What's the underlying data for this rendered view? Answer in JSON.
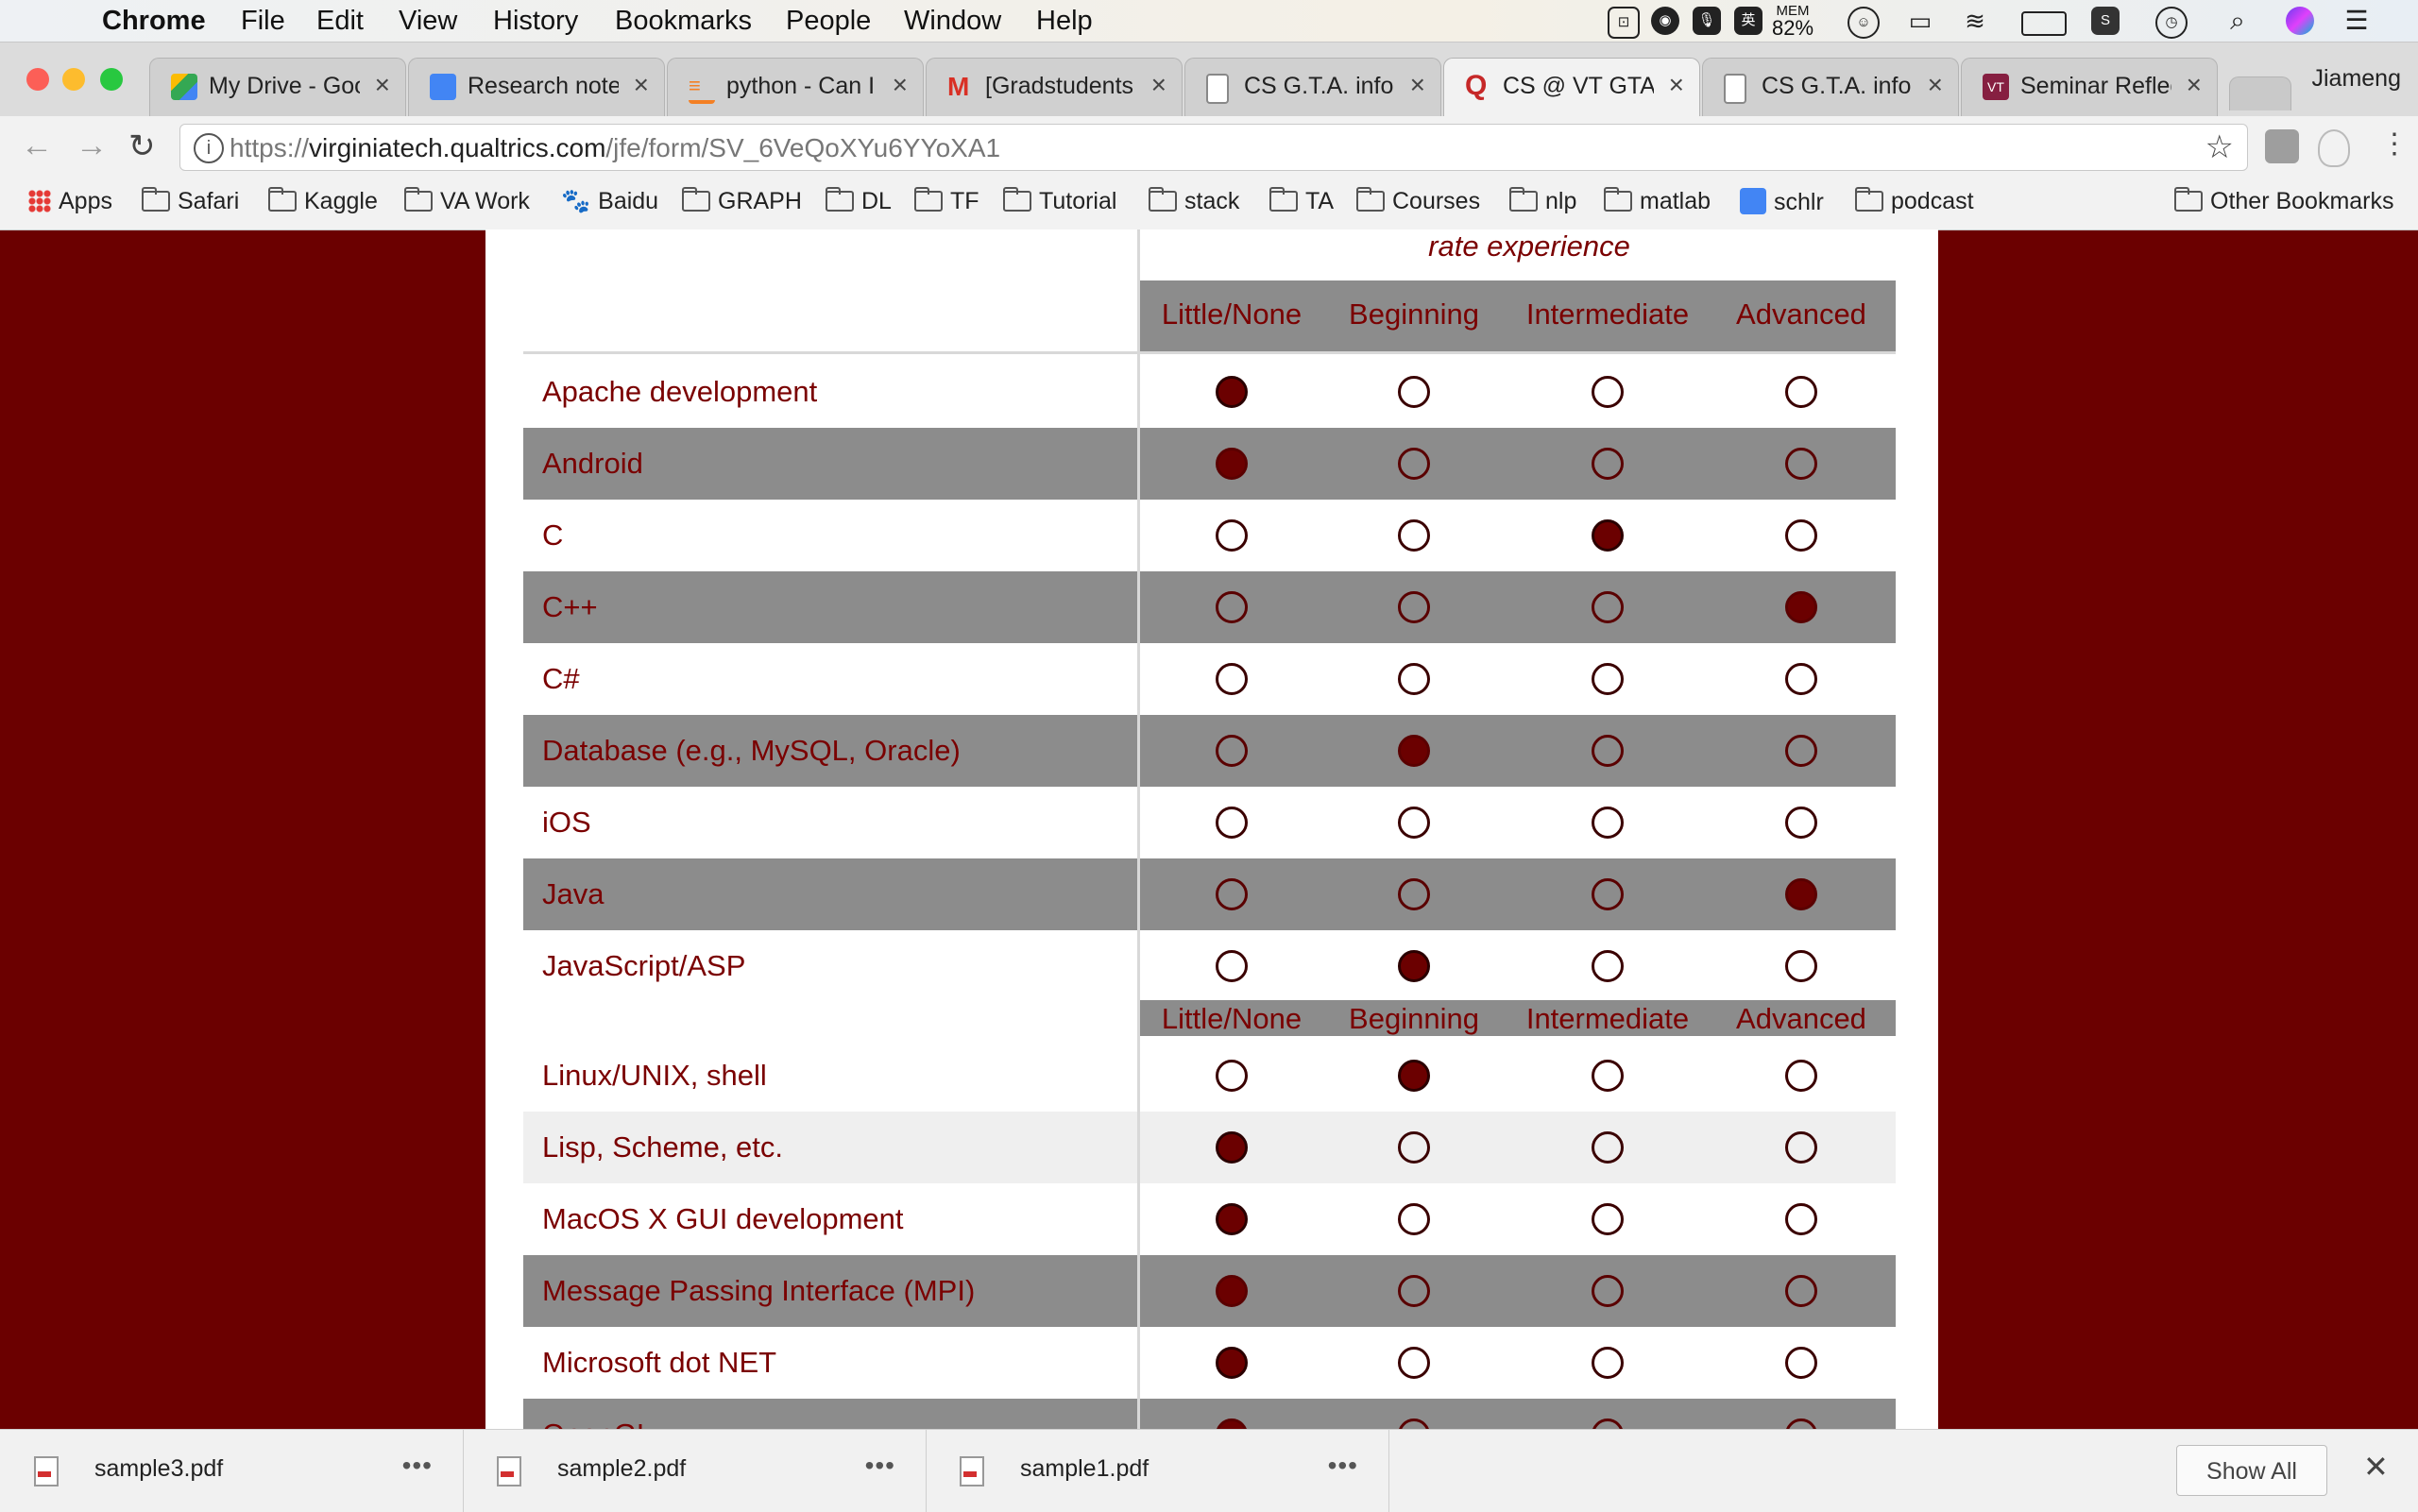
{
  "menubar": {
    "app": "Chrome",
    "items": [
      "File",
      "Edit",
      "View",
      "History",
      "Bookmarks",
      "People",
      "Window",
      "Help"
    ],
    "mem_label": "MEM",
    "mem_value": "82%"
  },
  "tabs": [
    {
      "title": "My Drive - Goo",
      "favicon_color": "#34a853"
    },
    {
      "title": "Research note",
      "favicon_color": "#4285f4"
    },
    {
      "title": "python - Can I",
      "favicon_color": "#f48024"
    },
    {
      "title": "[Gradstudents",
      "favicon_color": "#d93025"
    },
    {
      "title": "CS G.T.A. infor",
      "favicon_color": "#9e9e9e"
    },
    {
      "title": "CS @ VT GTA",
      "favicon_color": "#c62828",
      "active": true
    },
    {
      "title": "CS G.T.A. infor",
      "favicon_color": "#9e9e9e"
    },
    {
      "title": "Seminar Reflec",
      "favicon_color": "#861f41"
    }
  ],
  "profile_name": "Jiameng",
  "address_bar": {
    "scheme": "https://",
    "host": "virginiatech.qualtrics.com",
    "path": "/jfe/form/SV_6VeQoXYu6YYoXA1"
  },
  "bookmarks": {
    "apps": "Apps",
    "items": [
      "Safari",
      "Kaggle",
      "VA Work",
      "Baidu",
      "GRAPH",
      "DL",
      "TF",
      "Tutorial",
      "stack",
      "TA",
      "Courses",
      "nlp",
      "matlab",
      "schlr",
      "podcast"
    ],
    "other": "Other Bookmarks"
  },
  "survey": {
    "column_group_label": "rate experience",
    "columns": [
      "Little/None",
      "Beginning",
      "Intermediate",
      "Advanced"
    ],
    "rows": [
      {
        "label": "Apache development",
        "selected": 0
      },
      {
        "label": "Android",
        "selected": 0
      },
      {
        "label": "C",
        "selected": 2
      },
      {
        "label": "C++",
        "selected": 3
      },
      {
        "label": "C#",
        "selected": null
      },
      {
        "label": "Database (e.g., MySQL, Oracle)",
        "selected": 1
      },
      {
        "label": "iOS",
        "selected": null
      },
      {
        "label": "Java",
        "selected": 3
      },
      {
        "label": "JavaScript/ASP",
        "selected": 1
      },
      {
        "label": "Linux/UNIX, shell",
        "selected": 1
      },
      {
        "label": "Lisp, Scheme, etc.",
        "selected": 0
      },
      {
        "label": "MacOS X GUI development",
        "selected": 0
      },
      {
        "label": "Message Passing Interface (MPI)",
        "selected": 0
      },
      {
        "label": "Microsoft dot NET",
        "selected": 0
      },
      {
        "label": "OpenGL",
        "selected": 0
      }
    ]
  },
  "downloads": {
    "files": [
      "sample3.pdf",
      "sample2.pdf",
      "sample1.pdf"
    ],
    "show_all": "Show All"
  }
}
